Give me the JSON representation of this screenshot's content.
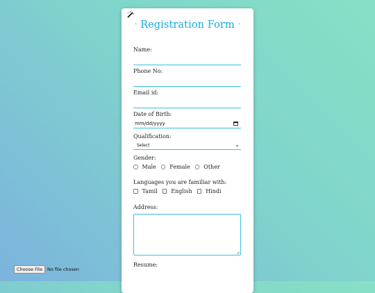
{
  "form": {
    "title": "Registration Form",
    "title_dot": "·",
    "toggle_icon": "magic-wand-icon",
    "accent_color": "#19a9dd",
    "name_label": "Name:",
    "phone_label": "Phone No:",
    "email_label": "Email id:",
    "dob_label": "Date of Birth:",
    "dob_placeholder": "mm/dd/yyyy",
    "qualification_label": "Qualification:",
    "qualification_selected": "Select",
    "gender_label": "Gender:",
    "gender_options": [
      "Male",
      "Female",
      "Other"
    ],
    "languages_label": "Languages you are familiar with:",
    "language_options": [
      "Tamil",
      "English",
      "Hindi"
    ],
    "address_label": "Address:",
    "resume_label": "Resume:",
    "file_button": "Choose File",
    "file_status": "No file chosen"
  }
}
